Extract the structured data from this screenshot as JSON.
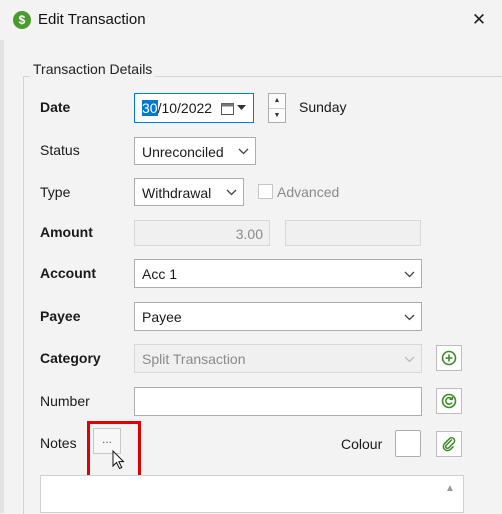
{
  "window": {
    "title": "Edit Transaction",
    "close_glyph": "✕",
    "app_icon_glyph": "$"
  },
  "group": {
    "legend": "Transaction Details"
  },
  "date": {
    "label": "Date",
    "value_selected": "30",
    "value_rest": "/10/2022",
    "weekday": "Sunday"
  },
  "status": {
    "label": "Status",
    "value": "Unreconciled"
  },
  "type": {
    "label": "Type",
    "value": "Withdrawal",
    "advanced_label": "Advanced",
    "advanced_checked": false
  },
  "amount": {
    "label": "Amount",
    "value": "3.00",
    "second_value": ""
  },
  "account": {
    "label": "Account",
    "value": "Acc 1"
  },
  "payee": {
    "label": "Payee",
    "value": "Payee"
  },
  "category": {
    "label": "Category",
    "value": "Split Transaction"
  },
  "number": {
    "label": "Number",
    "value": ""
  },
  "notes": {
    "label": "Notes",
    "button_label": "...",
    "value": ""
  },
  "colour": {
    "label": "Colour",
    "value": ""
  },
  "colors": {
    "accent": "#0078d7",
    "highlight": "#e00000",
    "app_icon": "#4a9b2f"
  }
}
